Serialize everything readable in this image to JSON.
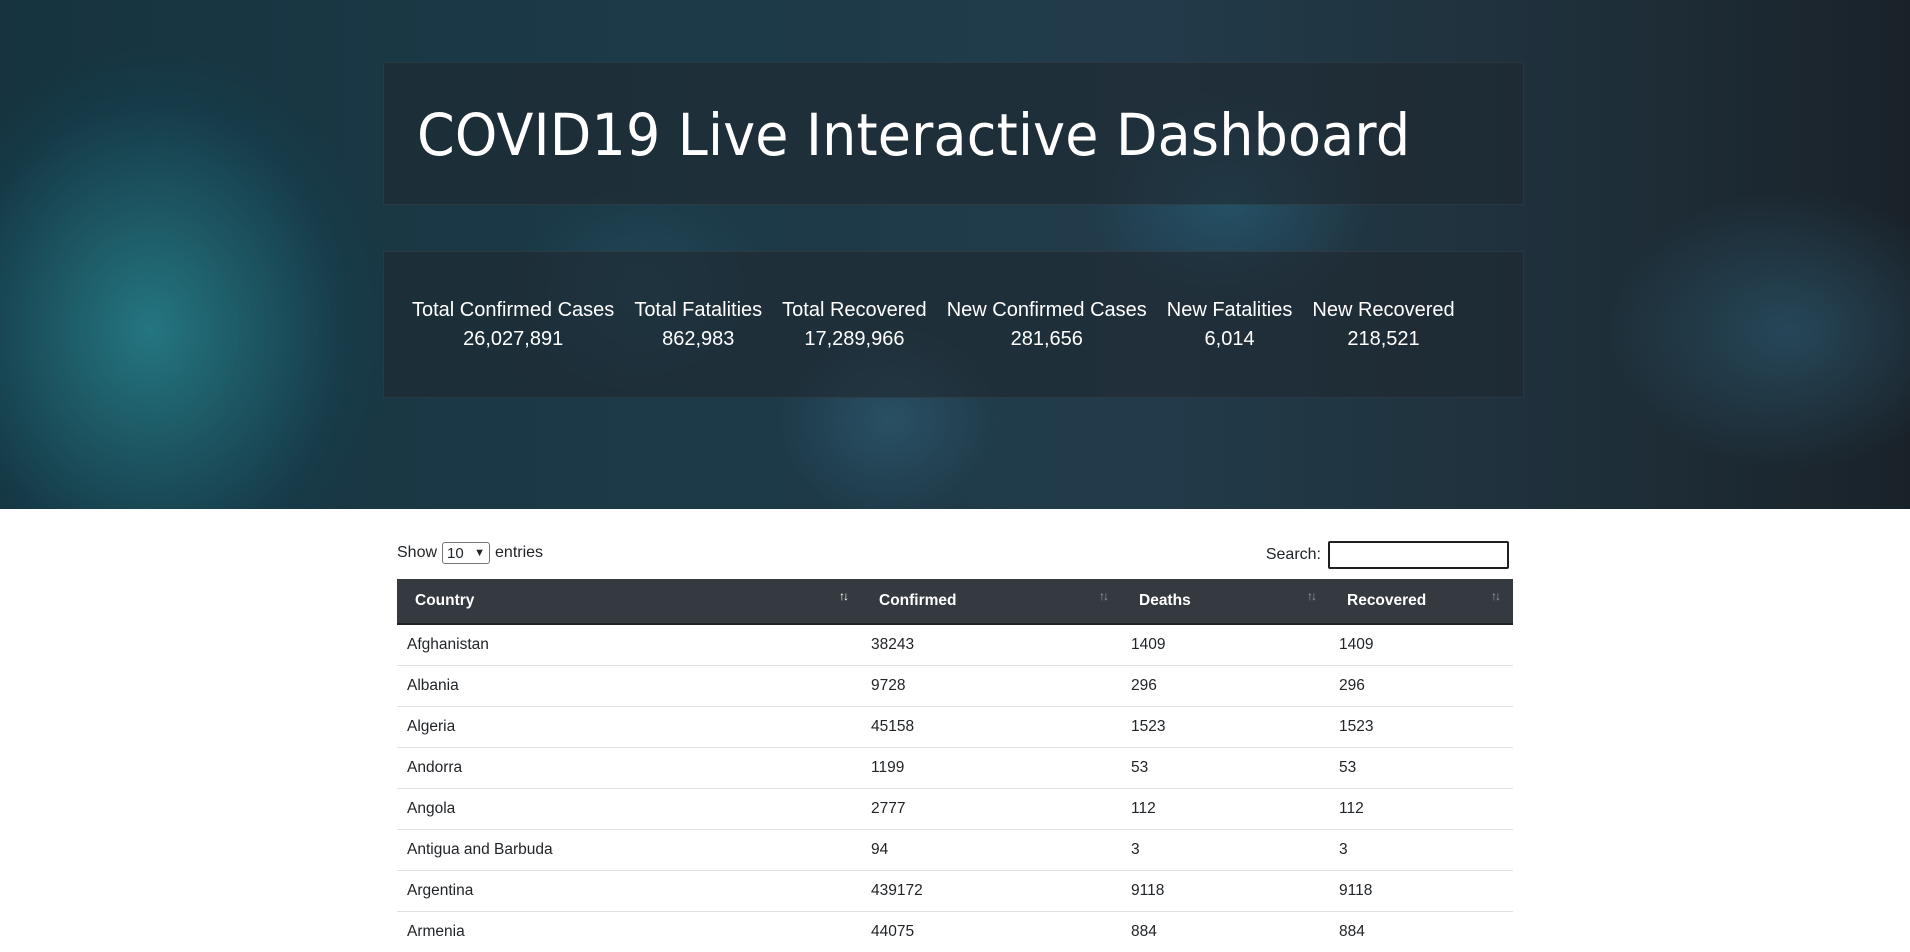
{
  "hero": {
    "title": "COVID19 Live Interactive Dashboard",
    "stats": [
      {
        "label": "Total Confirmed Cases",
        "value": "26,027,891"
      },
      {
        "label": "Total Fatalities",
        "value": "862,983"
      },
      {
        "label": "Total Recovered",
        "value": "17,289,966"
      },
      {
        "label": "New Confirmed Cases",
        "value": "281,656"
      },
      {
        "label": "New Fatalities",
        "value": "6,014"
      },
      {
        "label": "New Recovered",
        "value": "218,521"
      }
    ]
  },
  "table_controls": {
    "show_label": "Show",
    "entries_value": "10",
    "entries_label": "entries",
    "search_label": "Search:",
    "search_value": ""
  },
  "table": {
    "headers": [
      "Country",
      "Confirmed",
      "Deaths",
      "Recovered"
    ],
    "sort_icon": "sort-arrows-icon",
    "rows": [
      [
        "Afghanistan",
        "38243",
        "1409",
        "1409"
      ],
      [
        "Albania",
        "9728",
        "296",
        "296"
      ],
      [
        "Algeria",
        "45158",
        "1523",
        "1523"
      ],
      [
        "Andorra",
        "1199",
        "53",
        "53"
      ],
      [
        "Angola",
        "2777",
        "112",
        "112"
      ],
      [
        "Antigua and Barbuda",
        "94",
        "3",
        "3"
      ],
      [
        "Argentina",
        "439172",
        "9118",
        "9118"
      ],
      [
        "Armenia",
        "44075",
        "884",
        "884"
      ]
    ]
  },
  "colors": {
    "header_bg": "#343a40",
    "panel_bg": "rgba(30,40,48,0.62)"
  }
}
